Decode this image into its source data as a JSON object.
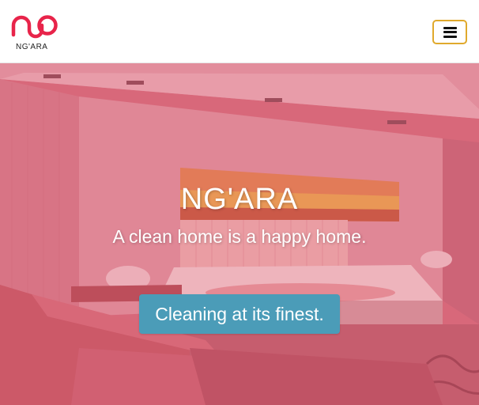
{
  "brand": {
    "logo_text": "NG'ARA",
    "accent_color": "#e8244a"
  },
  "navbar": {
    "menu_icon": "hamburger-menu-icon"
  },
  "hero": {
    "title": "NG'ARA",
    "subtitle": "A clean home is a happy home.",
    "cta_label": "Cleaning at its finest.",
    "cta_color": "#4b9cb8",
    "overlay_color": "#d6566e"
  }
}
